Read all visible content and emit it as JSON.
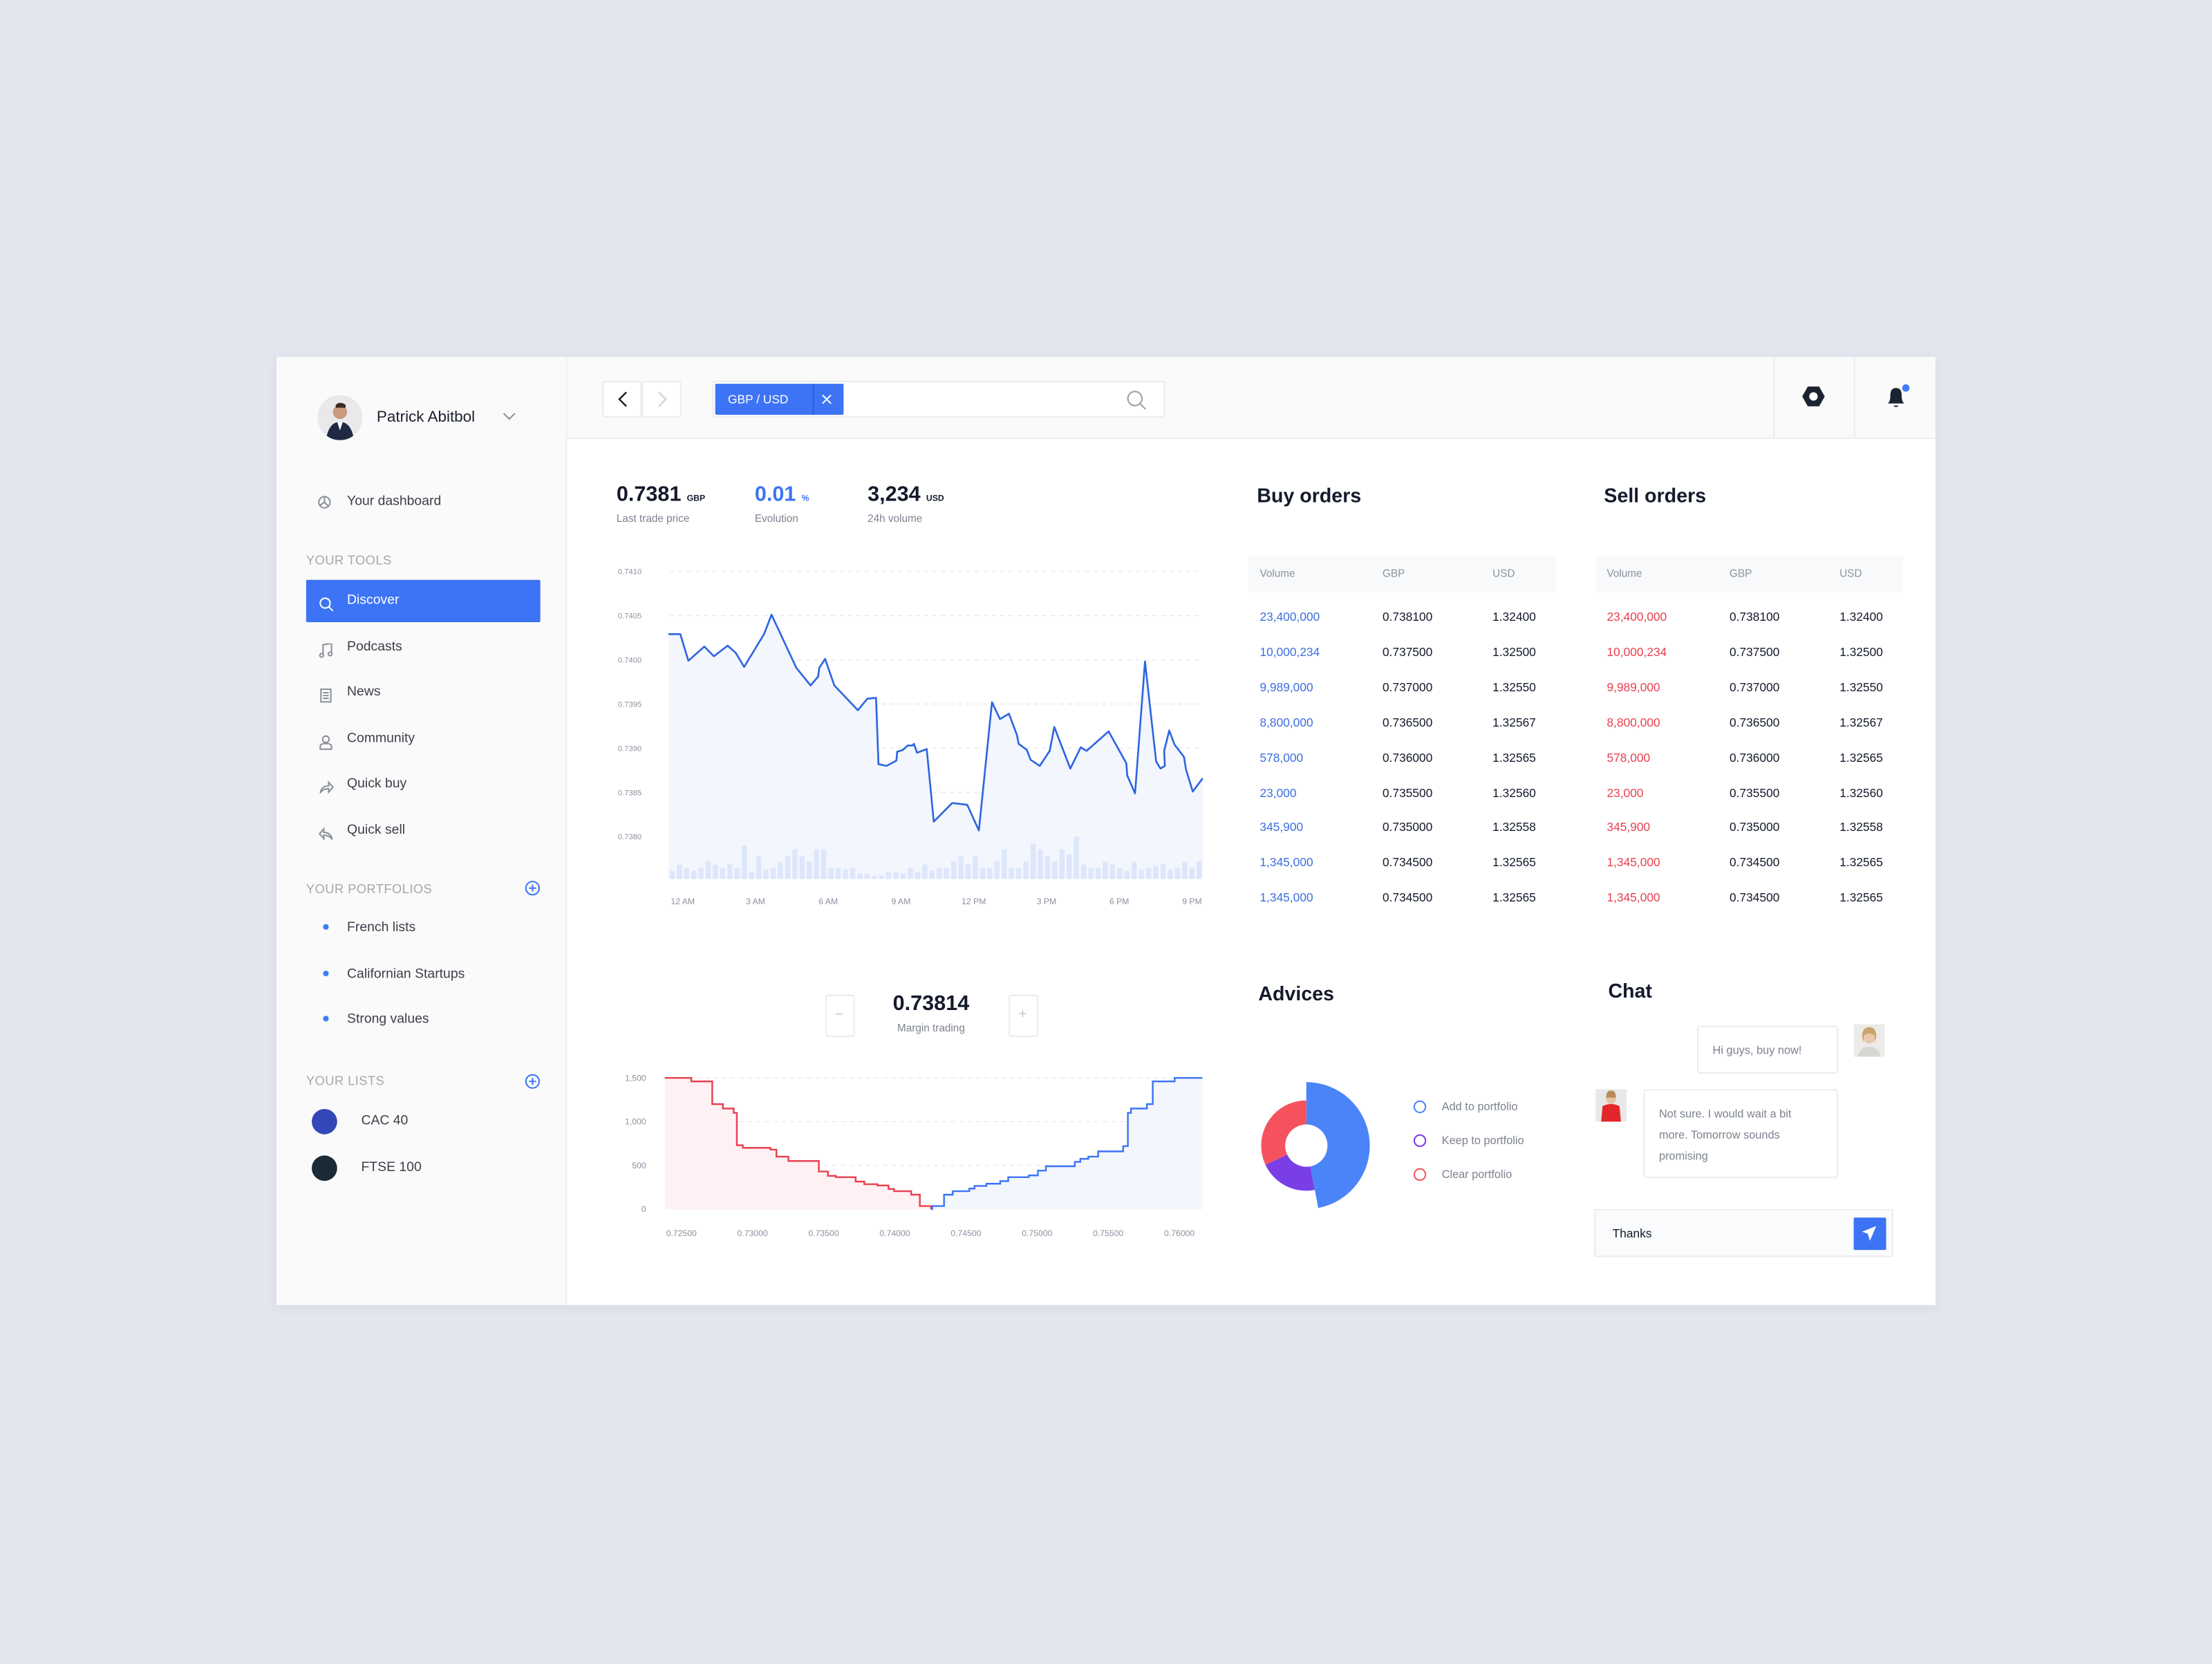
{
  "sidebar": {
    "user_name": "Patrick Abitbol",
    "dashboard_label": "Your dashboard",
    "tools_heading": "YOUR TOOLS",
    "tools": [
      {
        "label": "Discover",
        "icon": "search-icon",
        "active": true
      },
      {
        "label": "Podcasts",
        "icon": "music-icon"
      },
      {
        "label": "News",
        "icon": "news-icon"
      },
      {
        "label": "Community",
        "icon": "user-icon"
      },
      {
        "label": "Quick buy",
        "icon": "share-forward-icon"
      },
      {
        "label": "Quick sell",
        "icon": "reply-icon"
      }
    ],
    "portfolios_heading": "YOUR PORTFOLIOS",
    "portfolios": [
      "French lists",
      "Californian Startups",
      "Strong values"
    ],
    "lists_heading": "YOUR LISTS",
    "lists": [
      {
        "label": "CAC 40",
        "color": "#3347b8"
      },
      {
        "label": "FTSE 100",
        "color": "#1c2a38"
      }
    ]
  },
  "header": {
    "pair_tag": "GBP / USD",
    "notification_dot_color": "#3d7cf5"
  },
  "colors": {
    "accent": "#3d74f5",
    "buy": "#3d6fe0",
    "sell": "#e8414f",
    "purple": "#7a3ee6"
  },
  "stats": [
    {
      "value": "0.7381",
      "unit": "GBP",
      "label": "Last trade price"
    },
    {
      "value": "0.01",
      "unit": "%",
      "label": "Evolution"
    },
    {
      "value": "3,234",
      "unit": "USD",
      "label": "24h volume"
    }
  ],
  "margin": {
    "value": "0.73814",
    "label": "Margin trading",
    "minus": "−",
    "plus": "+"
  },
  "chart_data": [
    {
      "type": "line",
      "ylim": [
        0.738,
        0.741
      ],
      "y_ticks": [
        "0.7410",
        "0.7405",
        "0.7400",
        "0.7395",
        "0.7390",
        "0.7385",
        "0.7380"
      ],
      "x_ticks": [
        "12 AM",
        "3 AM",
        "6 AM",
        "9 AM",
        "12 PM",
        "3 PM",
        "6 PM",
        "9 PM"
      ],
      "grid": true,
      "x_hours": [
        -0.59,
        -0.1,
        0.23,
        0.89,
        1.28,
        1.85,
        2.18,
        2.53,
        3.35,
        3.66,
        4.68,
        5.27,
        5.58,
        5.63,
        5.87,
        6.25,
        7.22,
        7.61,
        7.97,
        8.07,
        8.4,
        8.81,
        8.84,
        9.07,
        9.27,
        9.47,
        9.53,
        9.66,
        10.06,
        10.35,
        11.11,
        11.73,
        12.21,
        12.75,
        13.08,
        13.45,
        13.78,
        13.85,
        14.19,
        14.34,
        14.72,
        15.13,
        15.32,
        15.98,
        16.41,
        16.65,
        17.56,
        18.29,
        18.33,
        18.65,
        19.06,
        19.52,
        19.7,
        19.88,
        19.85,
        20.06,
        20.28,
        20.67,
        20.75,
        21.03,
        21.44
      ],
      "values": [
        0.74029,
        0.74029,
        0.73999,
        0.74015,
        0.74004,
        0.74016,
        0.74008,
        0.73992,
        0.74029,
        0.74051,
        0.73991,
        0.73971,
        0.73981,
        0.73991,
        0.74001,
        0.73971,
        0.73943,
        0.73956,
        0.73957,
        0.73882,
        0.7388,
        0.73886,
        0.73896,
        0.73898,
        0.73903,
        0.73903,
        0.73905,
        0.73895,
        0.73899,
        0.73817,
        0.73838,
        0.73836,
        0.73807,
        0.73952,
        0.73933,
        0.73939,
        0.73915,
        0.73905,
        0.73898,
        0.73887,
        0.7388,
        0.73897,
        0.73924,
        0.73877,
        0.73901,
        0.73897,
        0.73919,
        0.73883,
        0.73869,
        0.73849,
        0.73998,
        0.73885,
        0.73877,
        0.7388,
        0.73897,
        0.7392,
        0.73904,
        0.7389,
        0.73876,
        0.73851,
        0.73866
      ],
      "volume_relative": [
        32,
        57,
        43,
        32,
        43,
        71,
        57,
        43,
        57,
        43,
        133,
        28,
        90,
        36,
        43,
        68,
        90,
        118,
        90,
        71,
        118,
        118,
        43,
        43,
        36,
        43,
        21,
        21,
        11,
        14,
        28,
        28,
        21,
        43,
        28,
        57,
        32,
        43,
        43,
        71,
        90,
        57,
        90,
        43,
        43,
        71,
        118,
        43,
        43,
        68,
        140,
        118,
        90,
        71,
        118,
        98,
        168,
        57,
        43,
        43,
        68,
        57,
        43,
        32,
        68,
        36,
        43,
        50,
        60,
        36,
        43,
        68,
        43,
        71
      ]
    },
    {
      "type": "area",
      "xlim": [
        0.72383,
        0.76162
      ],
      "ylim": [
        0,
        1500
      ],
      "y_ticks": [
        "1,500",
        "1,000",
        "500",
        "0"
      ],
      "x_ticks": [
        "0.72500",
        "0.73000",
        "0.73500",
        "0.74000",
        "0.74500",
        "0.75000",
        "0.75500",
        "0.76000"
      ],
      "grid": true,
      "bids": [
        [
          0.72383,
          1500
        ],
        [
          0.7257,
          1460
        ],
        [
          0.72717,
          1200
        ],
        [
          0.72792,
          1150
        ],
        [
          0.72868,
          1100
        ],
        [
          0.7289,
          730
        ],
        [
          0.72932,
          700
        ],
        [
          0.73126,
          680
        ],
        [
          0.73168,
          600
        ],
        [
          0.73252,
          550
        ],
        [
          0.73466,
          430
        ],
        [
          0.7353,
          380
        ],
        [
          0.73586,
          365
        ],
        [
          0.73725,
          315
        ],
        [
          0.73786,
          285
        ],
        [
          0.73878,
          270
        ],
        [
          0.73956,
          230
        ],
        [
          0.73995,
          205
        ],
        [
          0.74115,
          165
        ],
        [
          0.74176,
          35
        ],
        [
          0.74254,
          0
        ]
      ],
      "asks": [
        [
          0.74254,
          0
        ],
        [
          0.74263,
          35
        ],
        [
          0.74346,
          165
        ],
        [
          0.74407,
          205
        ],
        [
          0.74524,
          235
        ],
        [
          0.7456,
          265
        ],
        [
          0.74644,
          290
        ],
        [
          0.74741,
          320
        ],
        [
          0.74797,
          365
        ],
        [
          0.74942,
          385
        ],
        [
          0.75006,
          440
        ],
        [
          0.75062,
          490
        ],
        [
          0.75265,
          540
        ],
        [
          0.75304,
          575
        ],
        [
          0.7536,
          600
        ],
        [
          0.75429,
          660
        ],
        [
          0.75605,
          720
        ],
        [
          0.75638,
          1100
        ],
        [
          0.7566,
          1150
        ],
        [
          0.75772,
          1200
        ],
        [
          0.75813,
          1460
        ],
        [
          0.75967,
          1500
        ],
        [
          0.76162,
          1500
        ]
      ]
    },
    {
      "type": "pie",
      "series": [
        {
          "name": "Add to portfolio",
          "value": 47,
          "color": "#4a84f8"
        },
        {
          "name": "Keep to portfolio",
          "value": 21,
          "color": "#7a3ee6"
        },
        {
          "name": "Clear portfolio",
          "value": 32,
          "color": "#f5525e"
        }
      ]
    }
  ],
  "buy_orders": {
    "title": "Buy orders",
    "columns": [
      "Volume",
      "GBP",
      "USD"
    ],
    "rows": [
      [
        "23,400,000",
        "0.738100",
        "1.32400"
      ],
      [
        "10,000,234",
        "0.737500",
        "1.32500"
      ],
      [
        "9,989,000",
        "0.737000",
        "1.32550"
      ],
      [
        "8,800,000",
        "0.736500",
        "1.32567"
      ],
      [
        "578,000",
        "0.736000",
        "1.32565"
      ],
      [
        "23,000",
        "0.735500",
        "1.32560"
      ],
      [
        "345,900",
        "0.735000",
        "1.32558"
      ],
      [
        "1,345,000",
        "0.734500",
        "1.32565"
      ],
      [
        "1,345,000",
        "0.734500",
        "1.32565"
      ]
    ]
  },
  "sell_orders": {
    "title": "Sell orders",
    "columns": [
      "Volume",
      "GBP",
      "USD"
    ],
    "rows": [
      [
        "23,400,000",
        "0.738100",
        "1.32400"
      ],
      [
        "10,000,234",
        "0.737500",
        "1.32500"
      ],
      [
        "9,989,000",
        "0.737000",
        "1.32550"
      ],
      [
        "8,800,000",
        "0.736500",
        "1.32567"
      ],
      [
        "578,000",
        "0.736000",
        "1.32565"
      ],
      [
        "23,000",
        "0.735500",
        "1.32560"
      ],
      [
        "345,900",
        "0.735000",
        "1.32558"
      ],
      [
        "1,345,000",
        "0.734500",
        "1.32565"
      ],
      [
        "1,345,000",
        "0.734500",
        "1.32565"
      ]
    ]
  },
  "advices": {
    "title": "Advices"
  },
  "chat": {
    "title": "Chat",
    "messages": [
      {
        "text": "Hi guys, buy now!"
      },
      {
        "text": "Not sure. I would wait a bit more. Tomorrow sounds promising"
      }
    ],
    "input_value": "Thanks"
  }
}
